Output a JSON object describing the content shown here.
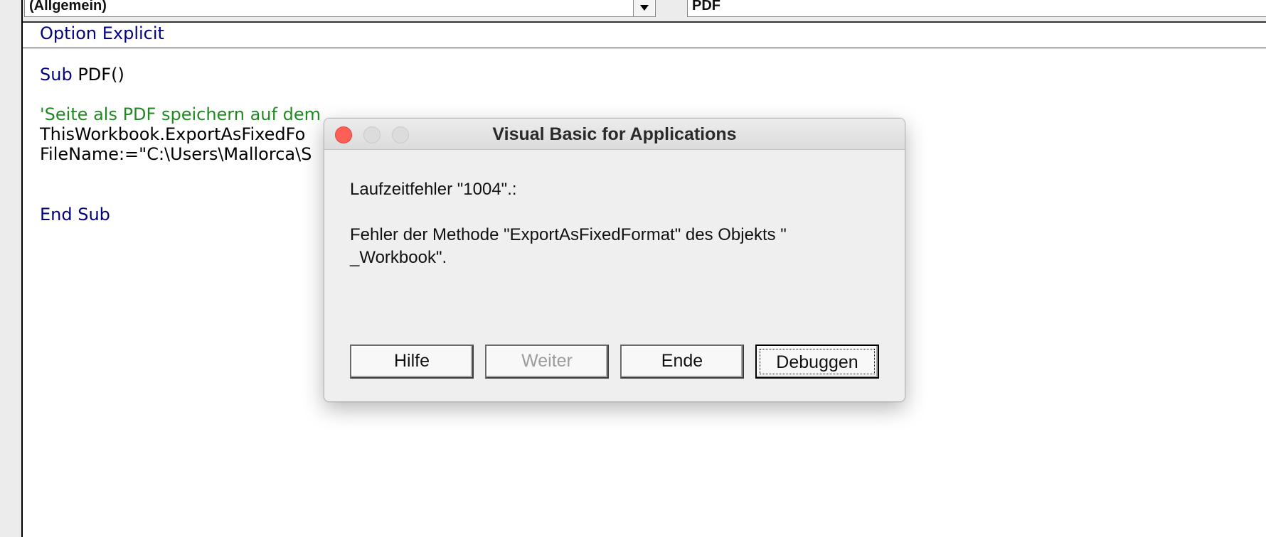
{
  "toolbar": {
    "object_combo": "(Allgemein)",
    "procedure_combo": "PDF"
  },
  "code": {
    "option_explicit": "Option Explicit",
    "sub_kw": "Sub",
    "sub_name": " PDF()",
    "comment": "'Seite als PDF speichern auf dem",
    "line_export": "ThisWorkbook.ExportAsFixedFo",
    "line_filename": "FileName:=\"C:\\Users\\Mallorca\\S",
    "end_sub": "End Sub"
  },
  "dialog": {
    "title": "Visual Basic for Applications",
    "error_line": "Laufzeitfehler \"1004\".:",
    "message_line1": "Fehler der Methode \"ExportAsFixedFormat\" des Objekts \"",
    "message_line2": "_Workbook\".",
    "buttons": {
      "help": "Hilfe",
      "continue": "Weiter",
      "end": "Ende",
      "debug": "Debuggen"
    }
  }
}
